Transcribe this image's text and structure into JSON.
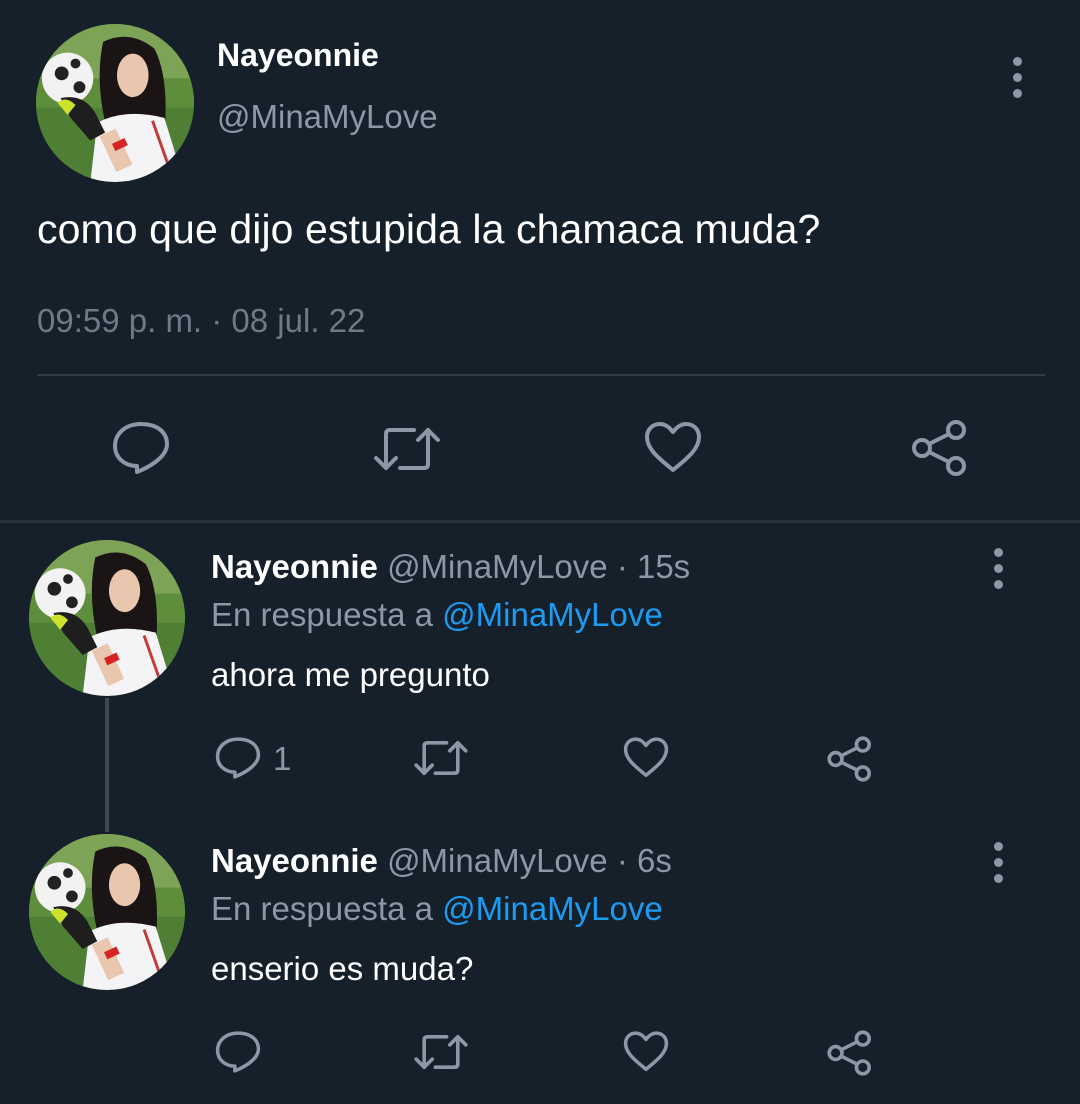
{
  "main_tweet": {
    "author_name": "Nayeonnie",
    "author_handle": "@MinaMyLove",
    "text": "como que dijo estupida la chamaca muda?",
    "timestamp": "09:59 p. m. · 08 jul. 22",
    "actions": [
      "reply-icon",
      "retweet-icon",
      "like-icon",
      "share-icon"
    ]
  },
  "replies": [
    {
      "author_name": "Nayeonnie",
      "author_handle": "@MinaMyLove",
      "time": "· 15s",
      "replying_to_label": "En respuesta a",
      "replying_to_handle": "@MinaMyLove",
      "text": "ahora me pregunto",
      "reply_count": "1"
    },
    {
      "author_name": "Nayeonnie",
      "author_handle": "@MinaMyLove",
      "time": "· 6s",
      "replying_to_label": "En respuesta a",
      "replying_to_handle": "@MinaMyLove",
      "text": "enserio es muda?",
      "reply_count": ""
    }
  ],
  "colors": {
    "background": "#15202b",
    "text_primary": "#ffffff",
    "text_secondary": "#8b98a5",
    "accent": "#1d9bf0",
    "divider": "#2f3b47"
  }
}
